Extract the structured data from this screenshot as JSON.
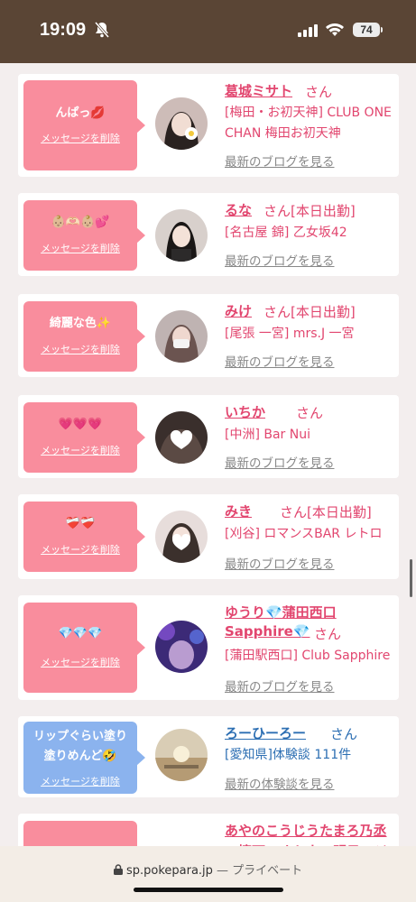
{
  "status": {
    "time": "19:09",
    "battery": "74"
  },
  "items": [
    {
      "message": "んぱっ💋",
      "delete": "メッセージを削除",
      "name": "葛城ミサト",
      "san": "さん",
      "info": "[梅田・お初天神] CLUB ONE CHAN 梅田お初天神",
      "blog": "最新のブログを見る"
    },
    {
      "message": "👶🏼🫶🏻👶🏼💕",
      "delete": "メッセージを削除",
      "name": "るな",
      "san": "さん[本日出勤]",
      "info": "[名古屋 錦] 乙女坂42",
      "blog": "最新のブログを見る"
    },
    {
      "message": "綺麗な色✨",
      "delete": "メッセージを削除",
      "name": "みけ",
      "san": "さん[本日出勤]",
      "info": "[尾張 一宮] mrs.J 一宮",
      "blog": "最新のブログを見る"
    },
    {
      "message": "💗💗💗",
      "delete": "メッセージを削除",
      "name": "いちか",
      "san": "さん",
      "info": "[中洲] Bar Nui",
      "blog": "最新のブログを見る"
    },
    {
      "message": "❤️‍🩹❤️‍🩹",
      "delete": "メッセージを削除",
      "name": "みき",
      "san": "さん[本日出勤]",
      "info": "[刈谷] ロマンスBAR レトロ",
      "blog": "最新のブログを見る"
    },
    {
      "message": "💎💎💎",
      "delete": "メッセージを削除",
      "name": "ゆうり💎蒲田西口",
      "name2": "Sapphire💎",
      "san": "さん",
      "info": "[蒲田駅西口] Club Sapphire",
      "blog": "最新のブログを見る"
    },
    {
      "message": "リップぐらい塗り塗りめんど🤣",
      "delete": "メッセージを削除",
      "name": "ろーひーろー",
      "san": "さん",
      "info": "[愛知県]体験談 111件",
      "blog": "最新の体験談を見る"
    },
    {
      "name": "あやのこうじうたまろ乃丞",
      "name2": "の擦下のオトウの明日のジ"
    }
  ],
  "browser": {
    "url": "sp.pokepara.jp",
    "mode": "— プライベート"
  },
  "colors": {
    "pink": "#f98d9d",
    "blue": "#8bb3ee",
    "name_pink": "#e2466f",
    "name_blue": "#2d6fb3",
    "header": "#5a4535"
  }
}
